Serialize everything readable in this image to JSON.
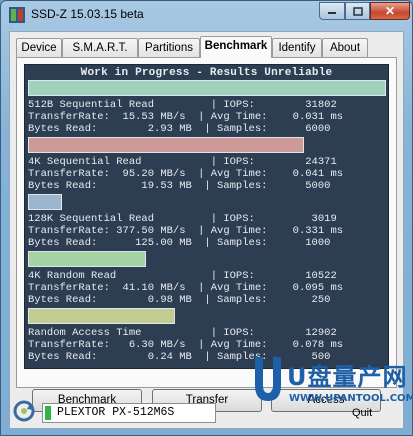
{
  "window": {
    "title": "SSD-Z 15.03.15 beta",
    "min_icon": "minimize-icon",
    "max_icon": "maximize-icon",
    "close_icon": "close-icon",
    "close_glyph": "✕"
  },
  "tabs": [
    {
      "label": "Device"
    },
    {
      "label": "S.M.A.R.T."
    },
    {
      "label": "Partitions"
    },
    {
      "label": "Benchmark",
      "active": true
    },
    {
      "label": "Identify"
    },
    {
      "label": "About"
    }
  ],
  "console": {
    "header": "Work in Progress - Results Unreliable",
    "results": [
      {
        "l1": "512B Sequential Read         | IOPS:        31802",
        "l2": "TransferRate:  15.53 MB/s  | Avg Time:    0.031 ms",
        "l3": "Bytes Read:        2.93 MB  | Samples:      6000",
        "bar_fraction": 1.0,
        "bar_color": "#9ed2bd"
      },
      {
        "l1": "4K Sequential Read           | IOPS:        24371",
        "l2": "TransferRate:  95.20 MB/s  | Avg Time:    0.041 ms",
        "l3": "Bytes Read:       19.53 MB  | Samples:      5000",
        "bar_fraction": 0.77,
        "bar_color": "#cd9a97"
      },
      {
        "l1": "128K Sequential Read         | IOPS:         3019",
        "l2": "TransferRate: 377.50 MB/s  | Avg Time:    0.331 ms",
        "l3": "Bytes Read:      125.00 MB  | Samples:      1000",
        "bar_fraction": 0.095,
        "bar_color": "#9bb6cc"
      },
      {
        "l1": "4K Random Read               | IOPS:        10522",
        "l2": "TransferRate:  41.10 MB/s  | Avg Time:    0.095 ms",
        "l3": "Bytes Read:        0.98 MB  | Samples:       250",
        "bar_fraction": 0.33,
        "bar_color": "#a6d3a4"
      },
      {
        "l1": "Random Access Time           | IOPS:        12902",
        "l2": "TransferRate:   6.30 MB/s  | Avg Time:    0.078 ms",
        "l3": "Bytes Read:        0.24 MB  | Samples:       500",
        "bar_fraction": 0.41,
        "bar_color": "#c3cc92"
      }
    ]
  },
  "buttons": {
    "benchmark": "Benchmark",
    "transfer": "Transfer",
    "access": "Access"
  },
  "status": {
    "drive_name": "PLEXTOR PX-512M6S",
    "quit": "Quit",
    "drive_icon": "drive-refresh-icon"
  },
  "watermark": {
    "text": "U盘量产网",
    "url": "WWW.UPANTOOL.COM"
  }
}
